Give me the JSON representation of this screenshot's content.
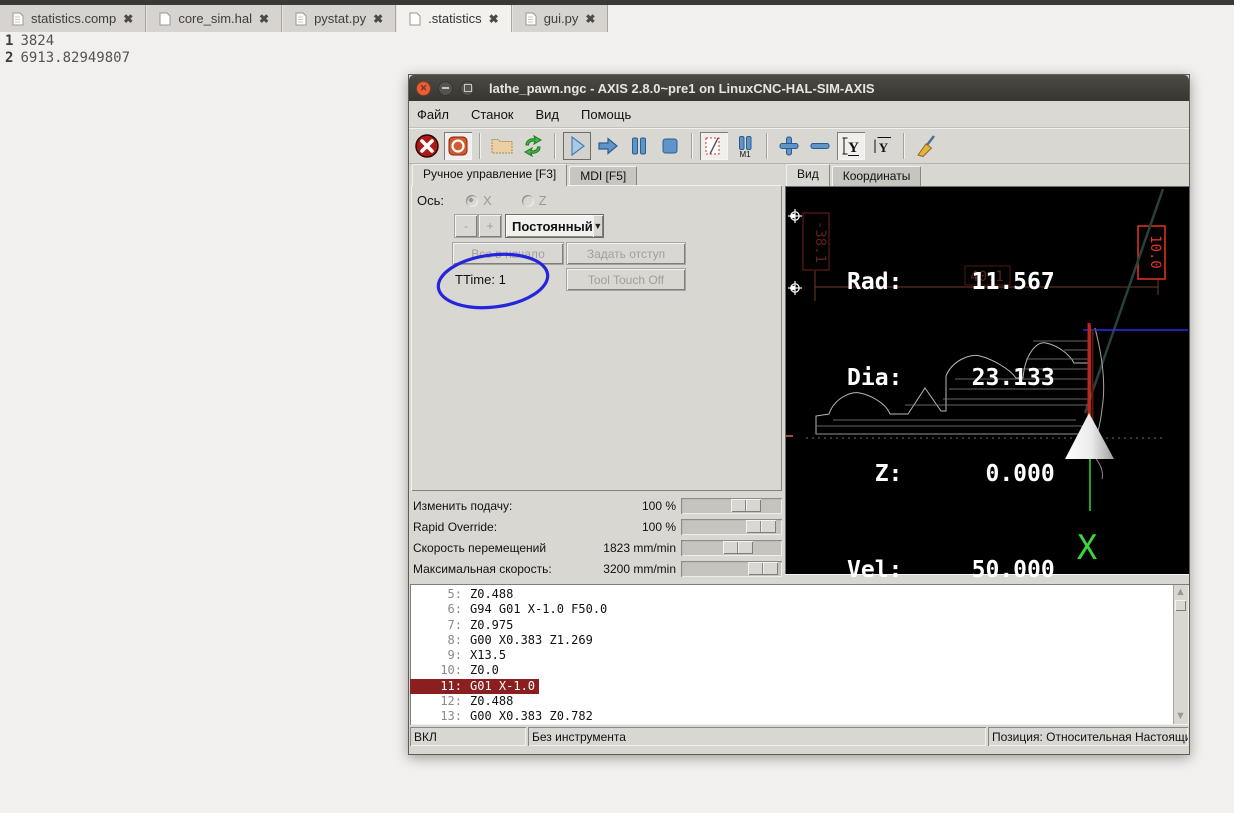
{
  "editor": {
    "tabs": [
      {
        "label": "statistics.comp",
        "close": "✖",
        "active": false
      },
      {
        "label": "core_sim.hal",
        "close": "✖",
        "active": false
      },
      {
        "label": "pystat.py",
        "close": "✖",
        "active": false
      },
      {
        "label": ".statistics",
        "close": "✖",
        "active": true
      },
      {
        "label": "gui.py",
        "close": "✖",
        "active": false
      }
    ],
    "lines": [
      {
        "num": "1",
        "text": "3824"
      },
      {
        "num": "2",
        "text": "6913.82949807"
      }
    ]
  },
  "axis_window": {
    "title": "lathe_pawn.ngc - AXIS 2.8.0~pre1 on LinuxCNC-HAL-SIM-AXIS",
    "menu": {
      "items": [
        "Файл",
        "Станок",
        "Вид",
        "Помощь"
      ]
    },
    "toolbar": {
      "icons": [
        "estop",
        "machine-power",
        "open-file",
        "reload-file",
        "run-program",
        "step-line",
        "pause",
        "stop",
        "skip-lines",
        "optional-pause-m1",
        "zoom-in",
        "zoom-out",
        "view-y",
        "view-y2",
        "clear-plot"
      ]
    },
    "left_tabs": [
      {
        "label": "Ручное управление [F3]"
      },
      {
        "label": "MDI [F5]"
      }
    ],
    "manual": {
      "axis_label": "Ось:",
      "radio_x": "X",
      "radio_z": "Z",
      "jog_minus": "-",
      "jog_plus": "+",
      "jog_mode": "Постоянный",
      "combo_arrow": "▼",
      "home_all": "Все в начало",
      "set_offset": "Задать отступ",
      "ttime": "TTime:  1",
      "tool_touch_off": "Tool Touch Off"
    },
    "overrides": [
      {
        "label": "Изменить подачу:",
        "value": "100 %"
      },
      {
        "label": "Rapid Override:",
        "value": "100 %"
      },
      {
        "label": "Скорость перемещений",
        "value": "1823 mm/min"
      },
      {
        "label": "Максимальная скорость:",
        "value": "3200 mm/min"
      }
    ],
    "right_tabs": [
      {
        "label": "Вид"
      },
      {
        "label": "Координаты"
      }
    ],
    "canvas": {
      "dro_lines": [
        "Rad:     11.567",
        "Dia:     23.133",
        "  Z:      0.000",
        "Vel:     50.000"
      ],
      "dim_label_left": "-38.1",
      "dim_label_mid": "40.1",
      "dim_label_right": "10.0",
      "axis_letter": "X",
      "colors": {
        "dim_red": "#5f2018",
        "bright_red": "#e43424",
        "path_blue": "#2a2aee",
        "tool_green": "#2fd42f"
      }
    },
    "gcode": {
      "lines": [
        {
          "num": "5:",
          "code": "Z0.488"
        },
        {
          "num": "6:",
          "code": "G94 G01 X-1.0 F50.0"
        },
        {
          "num": "7:",
          "code": "Z0.975"
        },
        {
          "num": "8:",
          "code": "G00 X0.383 Z1.269"
        },
        {
          "num": "9:",
          "code": "X13.5"
        },
        {
          "num": "10:",
          "code": "Z0.0"
        },
        {
          "num": "11:",
          "code": "G01 X-1.0"
        },
        {
          "num": "12:",
          "code": "Z0.488"
        },
        {
          "num": "13:",
          "code": "G00 X0.383 Z0.782"
        }
      ],
      "active_index": 6
    },
    "status": {
      "machine": "ВКЛ",
      "tool": "Без инструмента",
      "position": "Позиция: Относительная Настоящий"
    }
  },
  "annotation": {
    "shape": "blue-ellipse-around-ttime",
    "color": "#2525dd"
  }
}
